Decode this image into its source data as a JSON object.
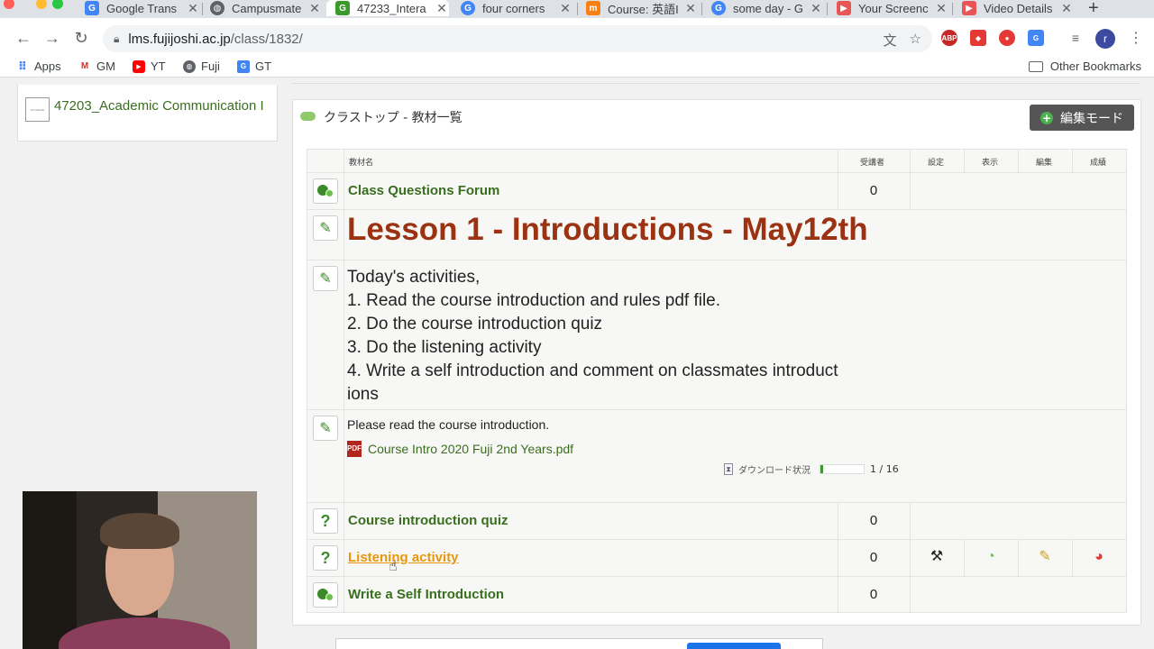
{
  "browser": {
    "tabs": [
      {
        "title": "Google Trans",
        "favicon": "google-translate-icon",
        "color": "#4285f4"
      },
      {
        "title": "Campusmate",
        "favicon": "globe-icon",
        "color": "#5f6368"
      },
      {
        "title": "47233_Intera",
        "favicon": "g-icon",
        "color": "#3a9a2a",
        "active": true
      },
      {
        "title": "four corners",
        "favicon": "google-icon",
        "color": "#4285f4"
      },
      {
        "title": "Course: 英語I",
        "favicon": "moodle-icon",
        "color": "#f98012"
      },
      {
        "title": "some day - G",
        "favicon": "google-icon",
        "color": "#4285f4"
      },
      {
        "title": "Your Screenc",
        "favicon": "screencast-icon",
        "color": "#e85555"
      },
      {
        "title": "Video Details",
        "favicon": "screencast-icon",
        "color": "#e85555"
      }
    ],
    "url_host": "lms.fujijoshi.ac.jp",
    "url_path": "/class/1832/",
    "profile_initial": "r",
    "bookmarks": [
      {
        "label": "Apps",
        "icon": "apps-grid-icon"
      },
      {
        "label": "GM",
        "icon": "gmail-icon"
      },
      {
        "label": "YT",
        "icon": "youtube-icon"
      },
      {
        "label": "Fuji",
        "icon": "globe-icon"
      },
      {
        "label": "GT",
        "icon": "google-translate-icon"
      }
    ],
    "other_bookmarks": "Other Bookmarks"
  },
  "sidebar": {
    "course_thumb_text": "NO IMAGE",
    "course_link": "47203_Academic Communication I"
  },
  "panel": {
    "title": "クラストップ - 教材一覧",
    "edit_mode_label": "編集モード",
    "columns": {
      "name": "教材名",
      "students": "受講者",
      "settings": "設定",
      "display": "表示",
      "edit": "編集",
      "grades": "成績"
    },
    "items": {
      "forum": {
        "title": "Class Questions Forum",
        "count": "0"
      },
      "lesson": {
        "title": "Lesson 1 - Introductions - May12th"
      },
      "activities": {
        "heading": "Today's activities,",
        "line1": "1.  Read the course introduction and rules pdf file.",
        "line2": "2.  Do the course introduction quiz",
        "line3": "3.  Do the listening activity",
        "line4": "4.  Write a self introduction and comment on classmates introduct",
        "line5": "ions"
      },
      "intro": {
        "text": "Please read the course introduction.",
        "pdf_link": "Course Intro 2020 Fuji 2nd Years.pdf",
        "download_label": "ダウンロード状況",
        "download_progress": "1 / 16",
        "download_fraction": 0.0625
      },
      "quiz": {
        "title": "Course introduction quiz",
        "count": "0"
      },
      "listening": {
        "title": "Listening activity",
        "count": "0"
      },
      "selfintro": {
        "title": "Write a Self Introduction",
        "count": "0"
      }
    }
  },
  "colors": {
    "link_green": "#3a6e1f",
    "lesson_brown": "#9b3313",
    "hover_orange": "#e8960c"
  }
}
